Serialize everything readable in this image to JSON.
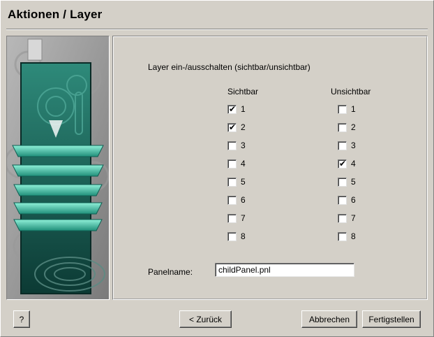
{
  "window": {
    "title": "Aktionen / Layer"
  },
  "main": {
    "heading": "Layer ein-/ausschalten  (sichtbar/unsichtbar)",
    "visible_header": "Sichtbar",
    "invisible_header": "Unsichtbar",
    "visible": [
      {
        "label": "1",
        "checked": true
      },
      {
        "label": "2",
        "checked": true
      },
      {
        "label": "3",
        "checked": false
      },
      {
        "label": "4",
        "checked": false
      },
      {
        "label": "5",
        "checked": false
      },
      {
        "label": "6",
        "checked": false
      },
      {
        "label": "7",
        "checked": false
      },
      {
        "label": "8",
        "checked": false
      }
    ],
    "invisible": [
      {
        "label": "1",
        "checked": false
      },
      {
        "label": "2",
        "checked": false
      },
      {
        "label": "3",
        "checked": false
      },
      {
        "label": "4",
        "checked": true
      },
      {
        "label": "5",
        "checked": false
      },
      {
        "label": "6",
        "checked": false
      },
      {
        "label": "7",
        "checked": false
      },
      {
        "label": "8",
        "checked": false
      }
    ],
    "panelname_label": "Panelname:",
    "panelname_value": "childPanel.pnl"
  },
  "footer": {
    "help_label": "?",
    "back_label": "< Zurück",
    "cancel_label": "Abbrechen",
    "finish_label": "Fertigstellen"
  },
  "colors": {
    "layer_teal": "#3fb8a0",
    "dialog_bg": "#d4d0c8"
  }
}
